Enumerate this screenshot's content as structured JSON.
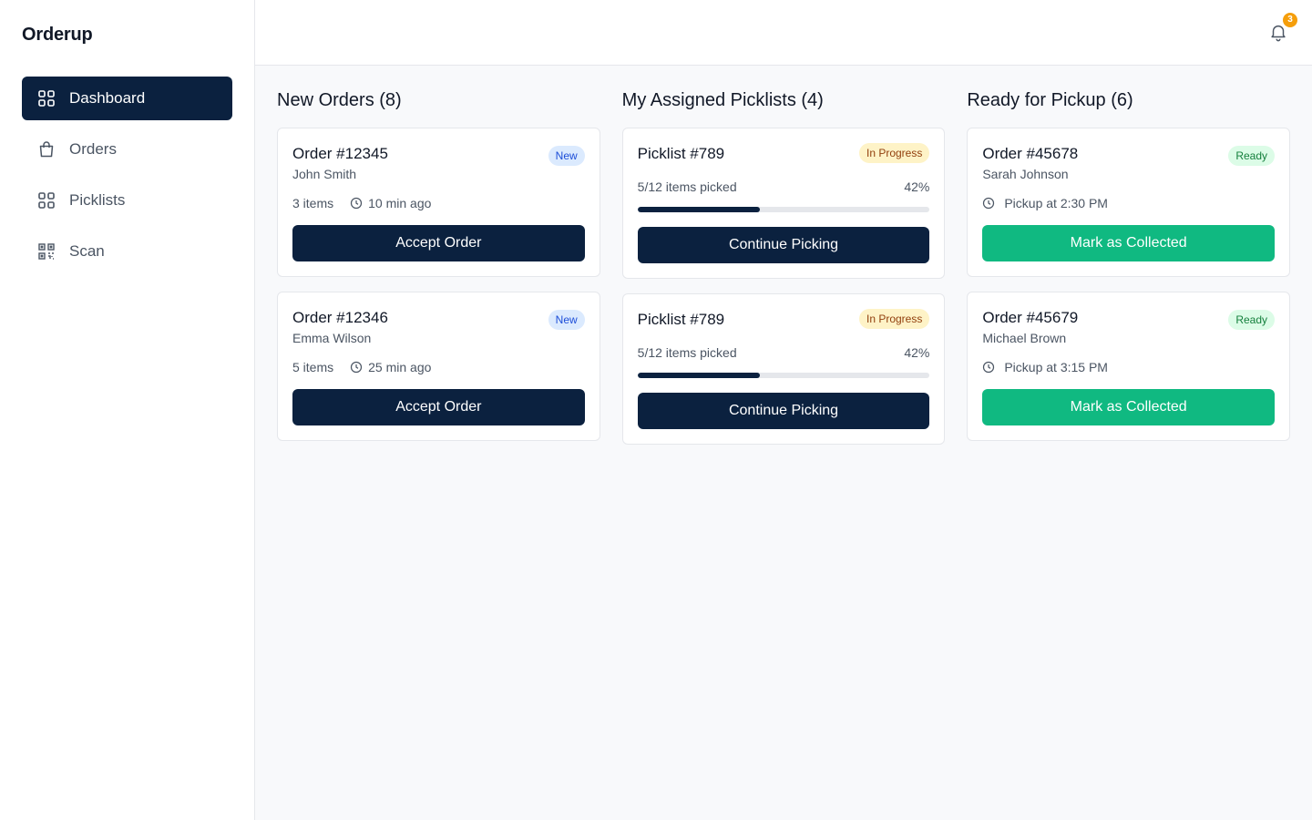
{
  "app": {
    "brand": "Orderup"
  },
  "sidebar": {
    "items": [
      {
        "label": "Dashboard",
        "icon": "grid-icon",
        "active": true
      },
      {
        "label": "Orders",
        "icon": "bag-icon",
        "active": false
      },
      {
        "label": "Picklists",
        "icon": "grid-icon",
        "active": false
      },
      {
        "label": "Scan",
        "icon": "qr-icon",
        "active": false
      }
    ]
  },
  "topbar": {
    "notifications_count": "3"
  },
  "columns": {
    "new_orders": {
      "title": "New Orders (8)",
      "cards": [
        {
          "title": "Order #12345",
          "customer": "John Smith",
          "badge": "New",
          "items": "3 items",
          "time": "10 min ago",
          "button": "Accept Order"
        },
        {
          "title": "Order #12346",
          "customer": "Emma Wilson",
          "badge": "New",
          "items": "5 items",
          "time": "25 min ago",
          "button": "Accept Order"
        }
      ]
    },
    "picklists": {
      "title": "My Assigned Picklists (4)",
      "cards": [
        {
          "title": "Picklist #789",
          "badge": "In Progress",
          "picked": "5/12 items picked",
          "percent_label": "42%",
          "progress": 0.42,
          "button": "Continue Picking"
        },
        {
          "title": "Picklist #789",
          "badge": "In Progress",
          "picked": "5/12 items picked",
          "percent_label": "42%",
          "progress": 0.42,
          "button": "Continue Picking"
        }
      ]
    },
    "ready": {
      "title": "Ready for Pickup (6)",
      "cards": [
        {
          "title": "Order #45678",
          "customer": "Sarah Johnson",
          "badge": "Ready",
          "pickup": "Pickup at 2:30 PM",
          "button": "Mark as Collected"
        },
        {
          "title": "Order #45679",
          "customer": "Michael Brown",
          "badge": "Ready",
          "pickup": "Pickup at 3:15 PM",
          "button": "Mark as Collected"
        }
      ]
    }
  },
  "colors": {
    "primary": "#0b213f",
    "success": "#10b981",
    "notification": "#f59e0b"
  }
}
